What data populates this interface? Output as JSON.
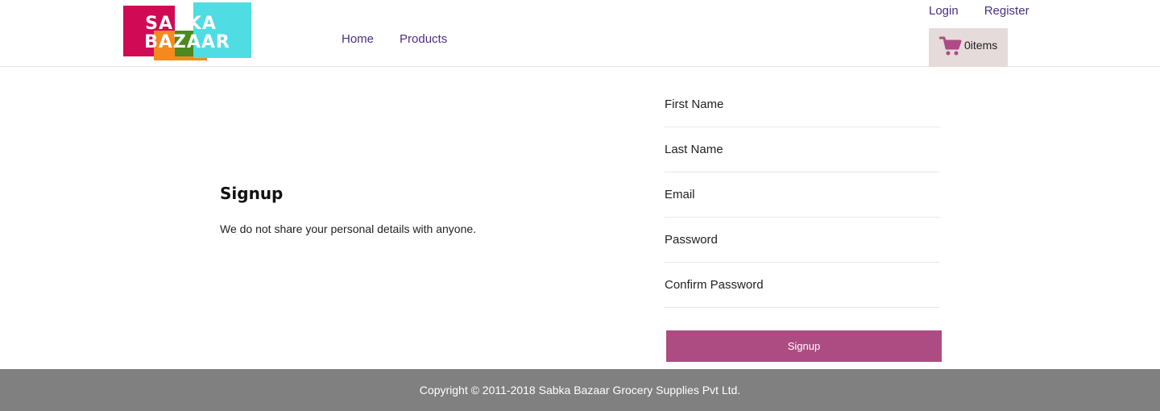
{
  "brand": {
    "logo_line1": "SABKA",
    "logo_line2": "BAZAAR",
    "colors": {
      "magenta": "#d10a55",
      "orange": "#f48a1f",
      "green": "#4a8a1f",
      "cyan": "#4fdde3"
    }
  },
  "nav": {
    "home": "Home",
    "products": "Products"
  },
  "auth": {
    "login": "Login",
    "register": "Register"
  },
  "cart": {
    "icon": "cart-icon",
    "label": "0items",
    "accent": "#ad4b83"
  },
  "intro": {
    "title": "Signup",
    "subtitle": "We do not share your personal details with anyone."
  },
  "form": {
    "first_name": {
      "placeholder": "First Name",
      "value": ""
    },
    "last_name": {
      "placeholder": "Last Name",
      "value": ""
    },
    "email": {
      "placeholder": "Email",
      "value": ""
    },
    "password": {
      "placeholder": "Password",
      "value": ""
    },
    "confirm_password": {
      "placeholder": "Confirm Password",
      "value": ""
    },
    "submit_label": "Signup",
    "submit_color": "#ad4b83"
  },
  "footer": {
    "copyright": "Copyright © 2011-2018 Sabka Bazaar Grocery Supplies Pvt Ltd."
  }
}
